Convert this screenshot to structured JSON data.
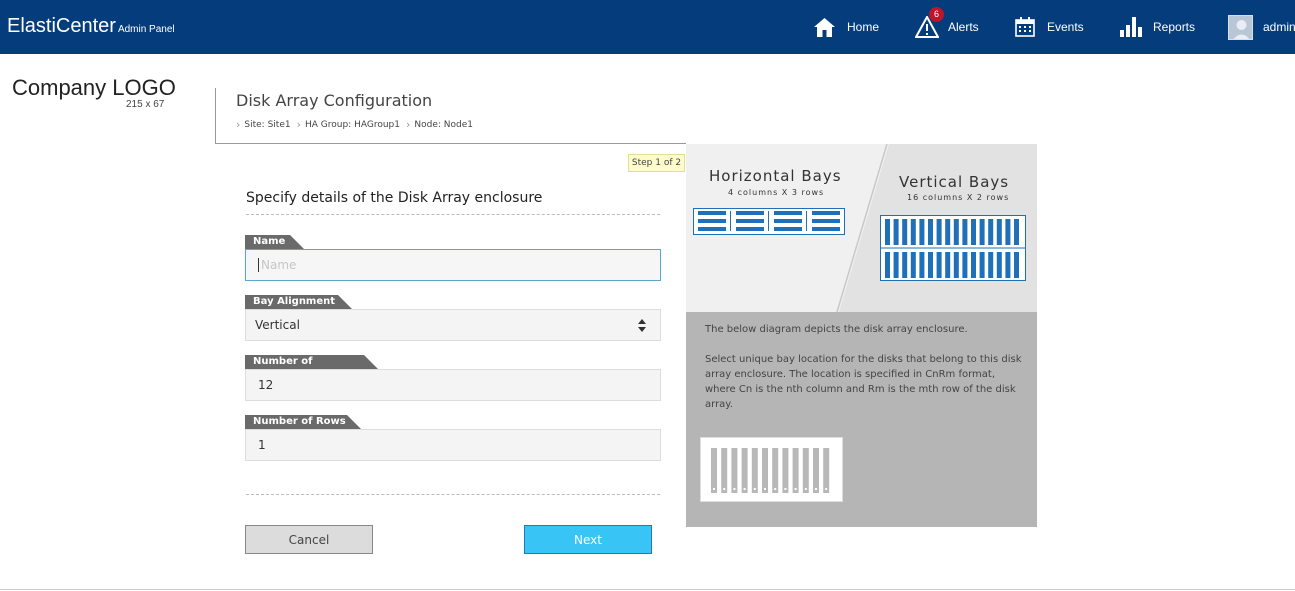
{
  "app": {
    "name": "ElastiCenter",
    "subtitle": "Admin Panel"
  },
  "nav": {
    "home": "Home",
    "alerts": "Alerts",
    "alerts_count": "6",
    "events": "Events",
    "reports": "Reports",
    "user": "admin"
  },
  "logo": {
    "text": "Company LOGO",
    "size": "215 x 67"
  },
  "page": {
    "title": "Disk Array Configuration",
    "breadcrumbs": [
      "Site: Site1",
      "HA Group: HAGroup1",
      "Node: Node1"
    ],
    "step": "Step 1 of 2"
  },
  "form": {
    "title": "Specify details of the Disk Array enclosure",
    "name_label": "Name",
    "name_value": "",
    "name_placeholder": "Name",
    "bay_alignment_label": "Bay Alignment",
    "bay_alignment_value": "Vertical",
    "columns_label": "Number of Columns",
    "columns_value": "12",
    "rows_label": "Number of Rows",
    "rows_value": "1",
    "cancel_label": "Cancel",
    "next_label": "Next"
  },
  "panel": {
    "horizontal_title": "Horizontal Bays",
    "horizontal_sub": "4 columns X 3 rows",
    "vertical_title": "Vertical Bays",
    "vertical_sub": "16 columns X 2 rows",
    "desc1": "The below diagram depicts the disk array enclosure.",
    "desc2": "Select unique bay location for the disks that belong to this disk array enclosure. The location is specified in CnRm format, where Cn is the nth column and Rm is the mth row of the disk array."
  },
  "colors": {
    "header_bg": "#053d7c",
    "accent": "#39c4f6",
    "bay_blue": "#1f6fb9",
    "badge_red": "#c0142a"
  },
  "icons": [
    "home-icon",
    "alert-icon",
    "calendar-icon",
    "reports-icon",
    "user-avatar-icon",
    "select-arrows-icon",
    "breadcrumb-chevron-icon"
  ]
}
